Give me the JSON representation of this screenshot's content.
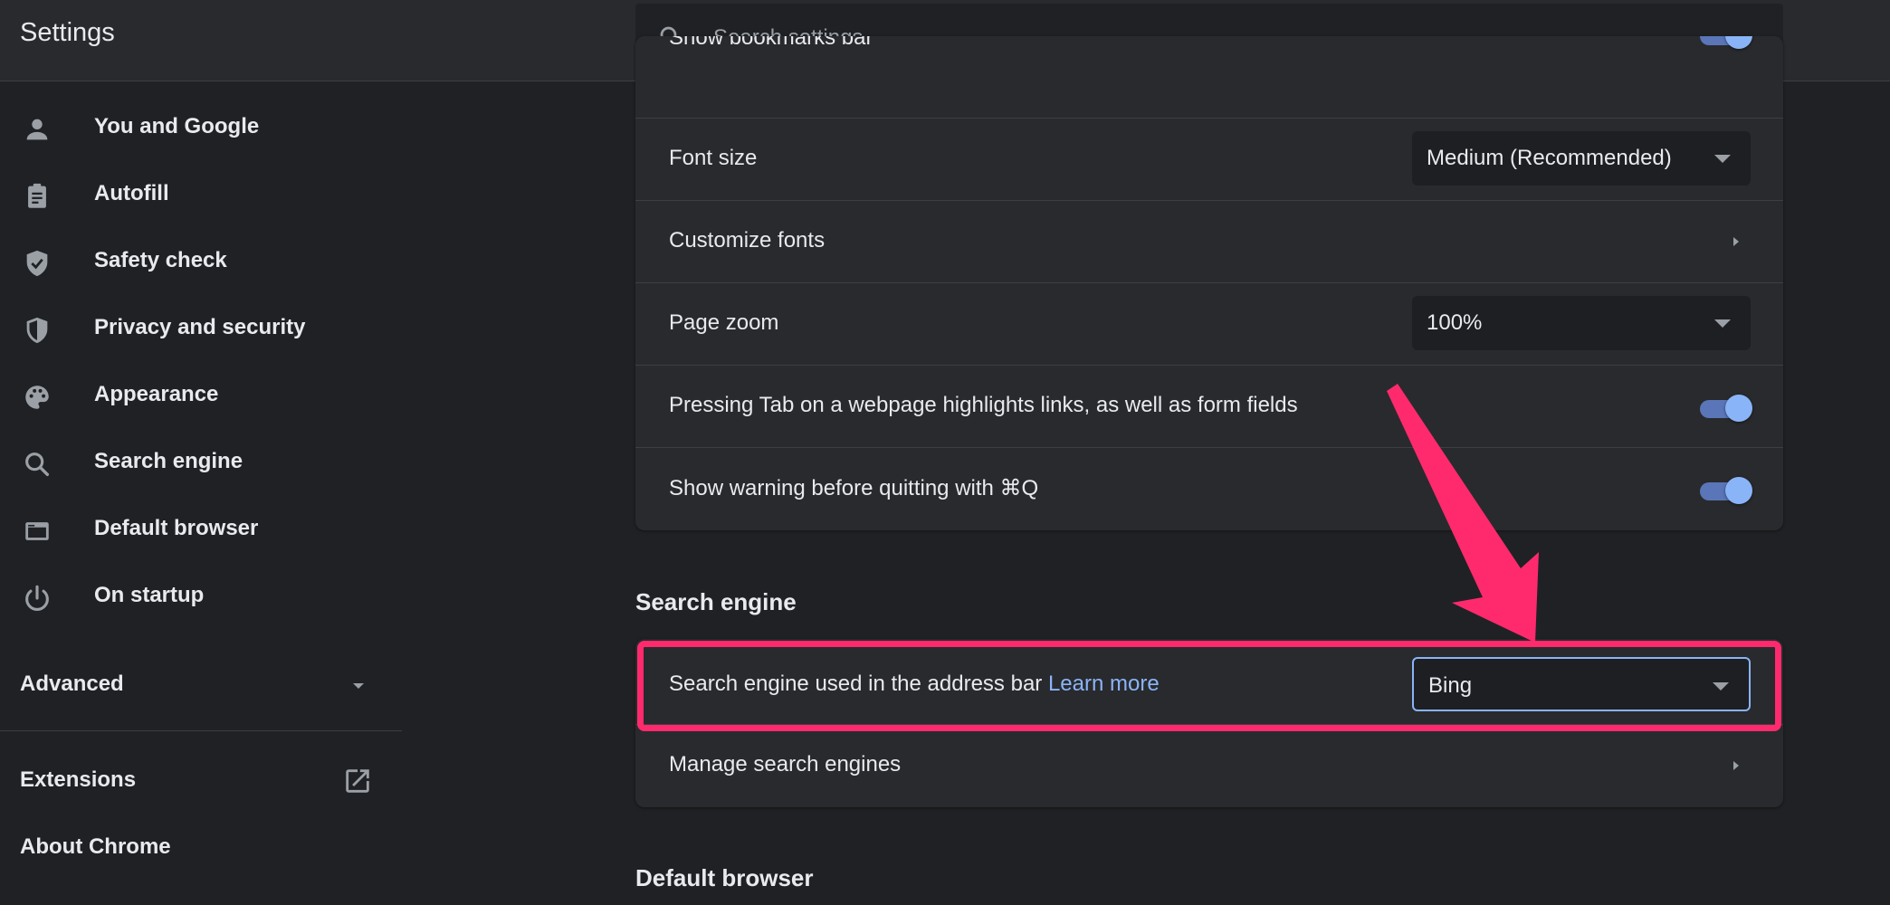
{
  "app": {
    "title": "Settings"
  },
  "search": {
    "placeholder": "Search settings"
  },
  "sidebar": {
    "items": [
      {
        "label": "You and Google",
        "icon": "person-icon"
      },
      {
        "label": "Autofill",
        "icon": "clipboard-icon"
      },
      {
        "label": "Safety check",
        "icon": "shield-check-icon"
      },
      {
        "label": "Privacy and security",
        "icon": "shield-icon"
      },
      {
        "label": "Appearance",
        "icon": "palette-icon"
      },
      {
        "label": "Search engine",
        "icon": "search-icon"
      },
      {
        "label": "Default browser",
        "icon": "browser-icon"
      },
      {
        "label": "On startup",
        "icon": "power-icon"
      }
    ],
    "advanced_label": "Advanced",
    "extensions_label": "Extensions",
    "about_label": "About Chrome"
  },
  "appearance_card": {
    "clipped_row_label": "Show bookmarks bar",
    "font_size": {
      "label": "Font size",
      "value": "Medium (Recommended)"
    },
    "customize_fonts": {
      "label": "Customize fonts"
    },
    "page_zoom": {
      "label": "Page zoom",
      "value": "100%"
    },
    "tab_highlight": {
      "label": "Pressing Tab on a webpage highlights links, as well as form fields",
      "enabled": true
    },
    "quit_warning": {
      "label": "Show warning before quitting with ⌘Q",
      "enabled": true
    }
  },
  "search_engine_section": {
    "title": "Search engine",
    "engine_row": {
      "label": "Search engine used in the address bar",
      "link": "Learn more",
      "value": "Bing"
    },
    "manage": {
      "label": "Manage search engines"
    }
  },
  "default_browser_section": {
    "title": "Default browser"
  },
  "colors": {
    "accent": "#8ab4f8",
    "highlight": "#ff2a6d",
    "background": "#202124",
    "card": "#292a2d"
  }
}
